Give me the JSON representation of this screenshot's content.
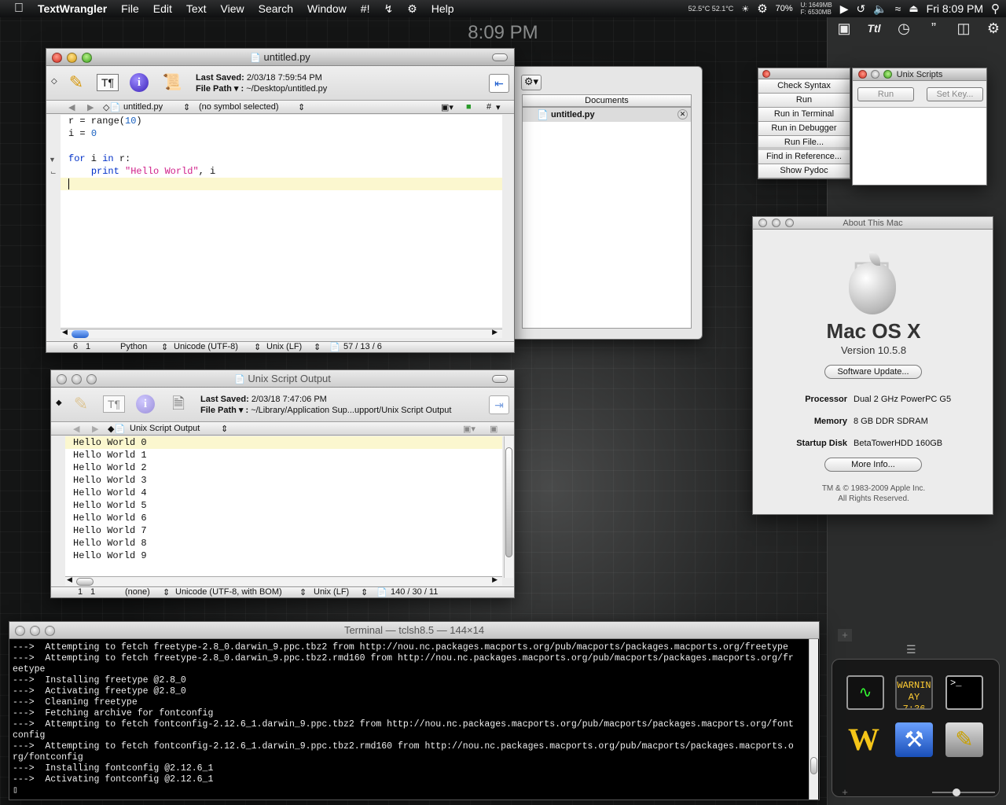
{
  "menubar": {
    "app": "TextWrangler",
    "items": [
      "File",
      "Edit",
      "Text",
      "View",
      "Search",
      "Window",
      "#!"
    ],
    "help": "Help",
    "temps": "52.5°C 52.1°C",
    "battery": "70%",
    "mem": [
      "U: 1649MB",
      "F: 6530MB"
    ],
    "clock": "Fri 8:09 PM"
  },
  "desktop": {
    "clock": "8:09 PM"
  },
  "editor": {
    "title": "untitled.py",
    "last_saved_label": "Last Saved:",
    "last_saved": "2/03/18 7:59:54 PM",
    "file_path_label": "File Path ▾ :",
    "file_path": "~/Desktop/untitled.py",
    "doc_name": "untitled.py",
    "symbol": "(no symbol selected)",
    "hash": "#",
    "code": [
      "r = range(10)",
      "i = 0",
      "",
      "for i in r:",
      "    print \"Hello World\", i",
      ""
    ],
    "status": {
      "line": "6",
      "col": "1",
      "lang": "Python",
      "encoding": "Unicode (UTF-8)",
      "linebreaks": "Unix (LF)",
      "counts": "57 / 13 / 6"
    }
  },
  "documents": {
    "header": "Documents",
    "item": "untitled.py"
  },
  "script_buttons": [
    "Check Syntax",
    "Run",
    "Run in Terminal",
    "Run in Debugger",
    "Run File...",
    "Find in Reference...",
    "Show Pydoc"
  ],
  "unix_scripts": {
    "title": "Unix Scripts",
    "run": "Run",
    "set_key": "Set Key..."
  },
  "about": {
    "title": "About This Mac",
    "os": "Mac OS X",
    "version": "Version 10.5.8",
    "update": "Software Update...",
    "processor_label": "Processor",
    "processor": "Dual 2 GHz PowerPC G5",
    "memory_label": "Memory",
    "memory": "8 GB DDR SDRAM",
    "disk_label": "Startup Disk",
    "disk": "BetaTowerHDD 160GB",
    "more": "More Info...",
    "copyright": "TM & © 1983-2009 Apple Inc.",
    "rights": "All Rights Reserved."
  },
  "output": {
    "title": "Unix Script Output",
    "last_saved_label": "Last Saved:",
    "last_saved": "2/03/18 7:47:06 PM",
    "file_path_label": "File Path ▾ :",
    "file_path": "~/Library/Application Sup...upport/Unix Script Output",
    "doc_name": "Unix Script Output",
    "lines": [
      "Hello World 0",
      "Hello World 1",
      "Hello World 2",
      "Hello World 3",
      "Hello World 4",
      "Hello World 5",
      "Hello World 6",
      "Hello World 7",
      "Hello World 8",
      "Hello World 9"
    ],
    "status": {
      "line": "1",
      "col": "1",
      "lang": "(none)",
      "encoding": "Unicode (UTF-8, with BOM)",
      "linebreaks": "Unix (LF)",
      "counts": "140 / 30 / 11"
    }
  },
  "terminal": {
    "title": "Terminal — tclsh8.5 — 144×14",
    "text": "--->  Attempting to fetch freetype-2.8_0.darwin_9.ppc.tbz2 from http://nou.nc.packages.macports.org/pub/macports/packages.macports.org/freetype\n--->  Attempting to fetch freetype-2.8_0.darwin_9.ppc.tbz2.rmd160 from http://nou.nc.packages.macports.org/pub/macports/packages.macports.org/fr\neetype\n--->  Installing freetype @2.8_0\n--->  Activating freetype @2.8_0\n--->  Cleaning freetype\n--->  Fetching archive for fontconfig\n--->  Attempting to fetch fontconfig-2.12.6_1.darwin_9.ppc.tbz2 from http://nou.nc.packages.macports.org/pub/macports/packages.macports.org/font\nconfig\n--->  Attempting to fetch fontconfig-2.12.6_1.darwin_9.ppc.tbz2.rmd160 from http://nou.nc.packages.macports.org/pub/macports/packages.macports.o\nrg/fontconfig\n--->  Installing fontconfig @2.12.6_1\n--->  Activating fontconfig @2.12.6_1\n▯"
  },
  "dock": {
    "warn": "WARNIN",
    "time": "AY 7:36"
  }
}
